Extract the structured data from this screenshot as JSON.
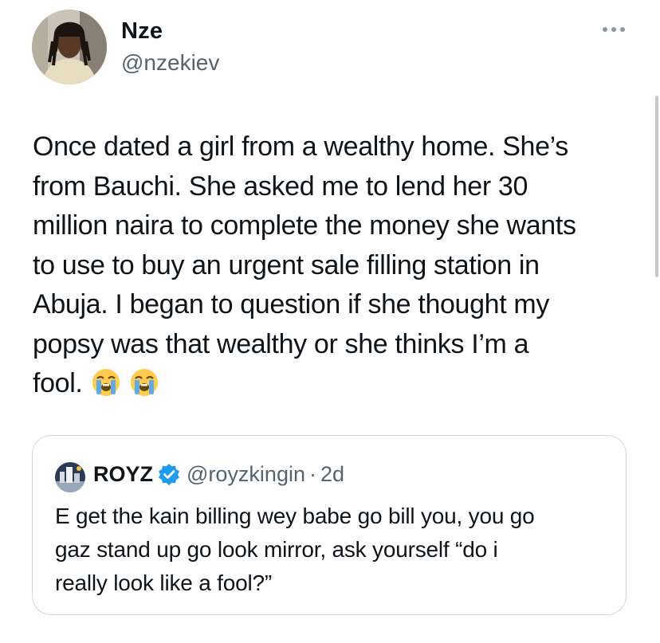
{
  "author": {
    "display_name": "Nze",
    "handle": "@nzekiev"
  },
  "tweet": {
    "text": "Once dated a girl from a wealthy home. She’s\nfrom Bauchi. She asked me to lend her 30\nmillion naira to complete the money she wants\nto use to buy an urgent sale filling station in\nAbuja. I began to question if she thought my\npopsy was that wealthy or she thinks I’m a\nfool.",
    "emojis": [
      "loudly-crying-face",
      "loudly-crying-face"
    ]
  },
  "quoted_tweet": {
    "display_name": "ROYZ",
    "verified": true,
    "handle": "@royzkingin",
    "separator": "·",
    "time": "2d",
    "text": "E get the kain billing wey babe go bill you, you go\ngaz stand up go look mirror, ask yourself  “do i\nreally look like a fool?”"
  },
  "icons": {
    "more": "more-horizontal-icon",
    "verified": "verified-badge-icon"
  },
  "colors": {
    "text": "#0f1419",
    "secondary": "#536471",
    "border": "#cfd9de",
    "verified": "#1d9bf0",
    "emoji": "#ffcc4d"
  }
}
